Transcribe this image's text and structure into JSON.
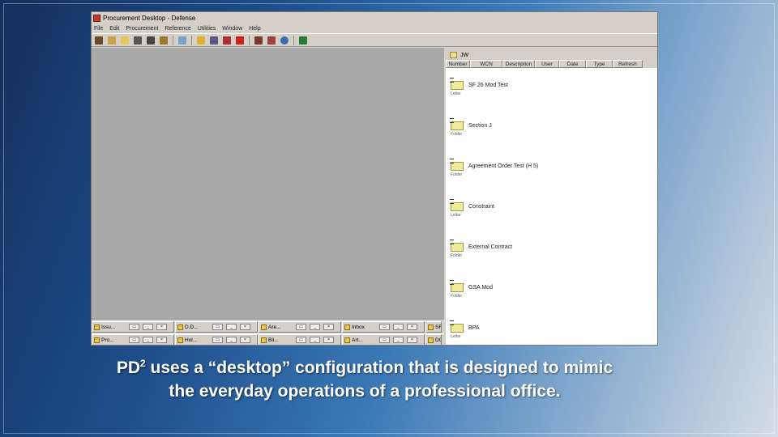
{
  "app": {
    "title": "Procurement Desktop - Defense",
    "menu": [
      "File",
      "Edit",
      "Procurement",
      "Reference",
      "Utilities",
      "Window",
      "Help"
    ],
    "toolbar_icons": [
      "doc-icon",
      "edit-icon",
      "folder-icon",
      "print-icon",
      "delete-icon",
      "arrow-icon",
      "new-icon",
      "mail-icon",
      "tool-icon",
      "check-icon",
      "stop-icon",
      "cabinet-icon",
      "bell-icon",
      "help-icon",
      "exit-icon"
    ]
  },
  "folder_window": {
    "title": "JW",
    "columns": [
      "Number",
      "WCN",
      "Description",
      "User",
      "Date",
      "Type",
      "Refresh"
    ],
    "items": [
      {
        "name": "SF 26 Mod Test",
        "type": "Letter"
      },
      {
        "name": "Section J",
        "type": "Folder"
      },
      {
        "name": "Agreement Order Test (H 5)",
        "type": "Folder"
      },
      {
        "name": "Constraint",
        "type": "Letter"
      },
      {
        "name": "External Contract",
        "type": "Folder"
      },
      {
        "name": "GSA Mod",
        "type": "Folder"
      },
      {
        "name": "BPA",
        "type": "Letter"
      }
    ]
  },
  "taskbar": {
    "row1": [
      "Issu...",
      "D.D...",
      "Are...",
      "Inbox",
      "SF"
    ],
    "row2": [
      "Pro...",
      "Hol...",
      "Bil...",
      "Art...",
      "DO"
    ]
  },
  "caption": {
    "part1": "PD",
    "sup": "2",
    "part2": " uses a “desktop” configuration that is designed to mimic",
    "line2": "the everyday operations of a professional office."
  },
  "colors": {
    "window_bg": "#d4d0c8",
    "workspace": "#a9a9a9",
    "folder_icon": "#f0ea9c"
  }
}
